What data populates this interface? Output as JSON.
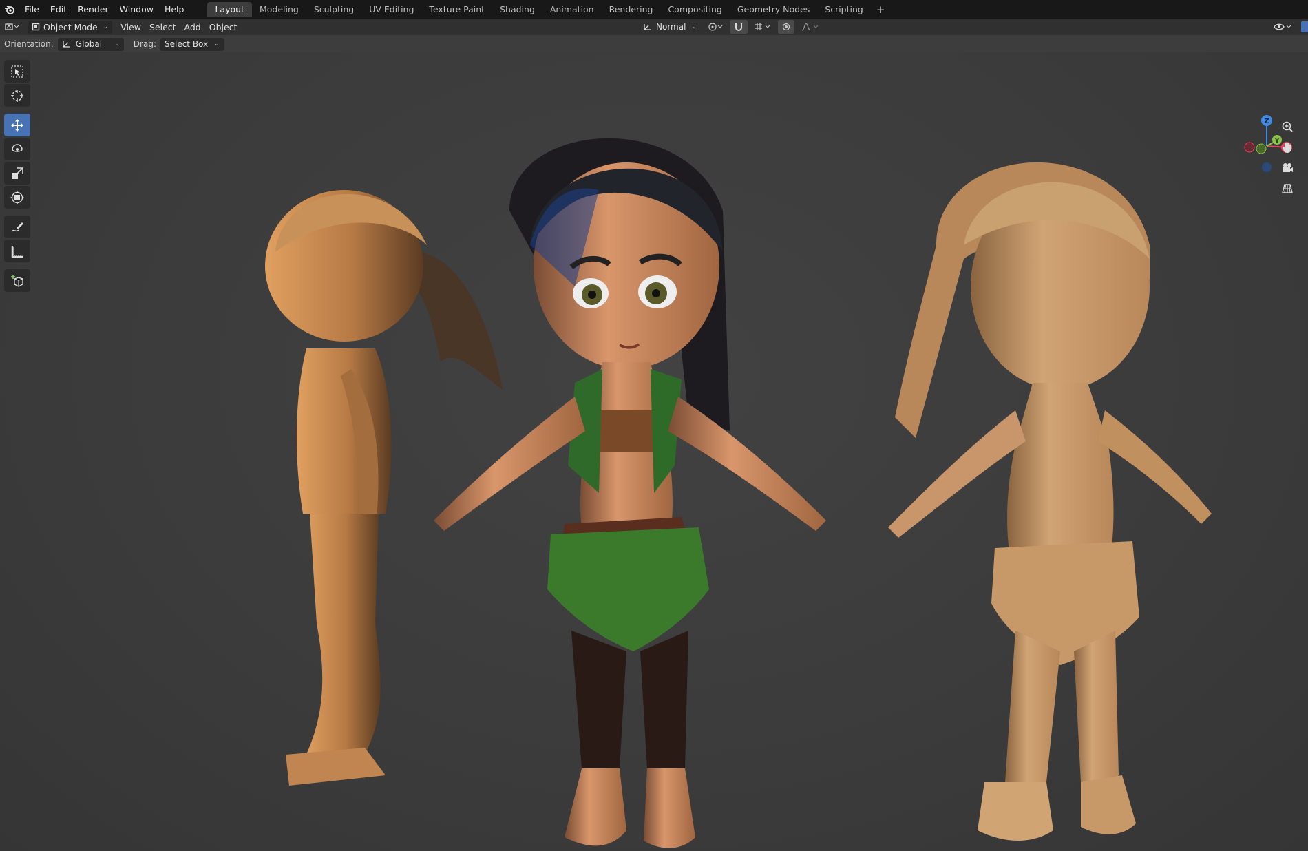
{
  "menu": {
    "items": [
      "File",
      "Edit",
      "Render",
      "Window",
      "Help"
    ]
  },
  "workspaces": {
    "tabs": [
      "Layout",
      "Modeling",
      "Sculpting",
      "UV Editing",
      "Texture Paint",
      "Shading",
      "Animation",
      "Rendering",
      "Compositing",
      "Geometry Nodes",
      "Scripting"
    ],
    "active": "Layout",
    "add_label": "+"
  },
  "header": {
    "mode": "Object Mode",
    "view": "View",
    "select": "Select",
    "add": "Add",
    "object": "Object",
    "transform_orientation": "Normal"
  },
  "toolsettings": {
    "orientation_label": "Orientation:",
    "orientation_value": "Global",
    "drag_label": "Drag:",
    "drag_value": "Select Box"
  },
  "gizmo": {
    "x_label": "X",
    "y_label": "Y",
    "z_label": "Z",
    "x_color": "#e8455a",
    "y_color": "#8bc34a",
    "z_color": "#3e8ce6"
  },
  "toolbar": {
    "tools": [
      "select-box",
      "cursor",
      "move",
      "rotate",
      "scale",
      "transform",
      "annotate",
      "measure",
      "add-cube"
    ],
    "active": "move",
    "active_color": "#4772b3"
  },
  "colors": {
    "topbar": "#181818",
    "header": "#303030",
    "viewport": "#3d3d3d",
    "clay": "#c48a54"
  }
}
